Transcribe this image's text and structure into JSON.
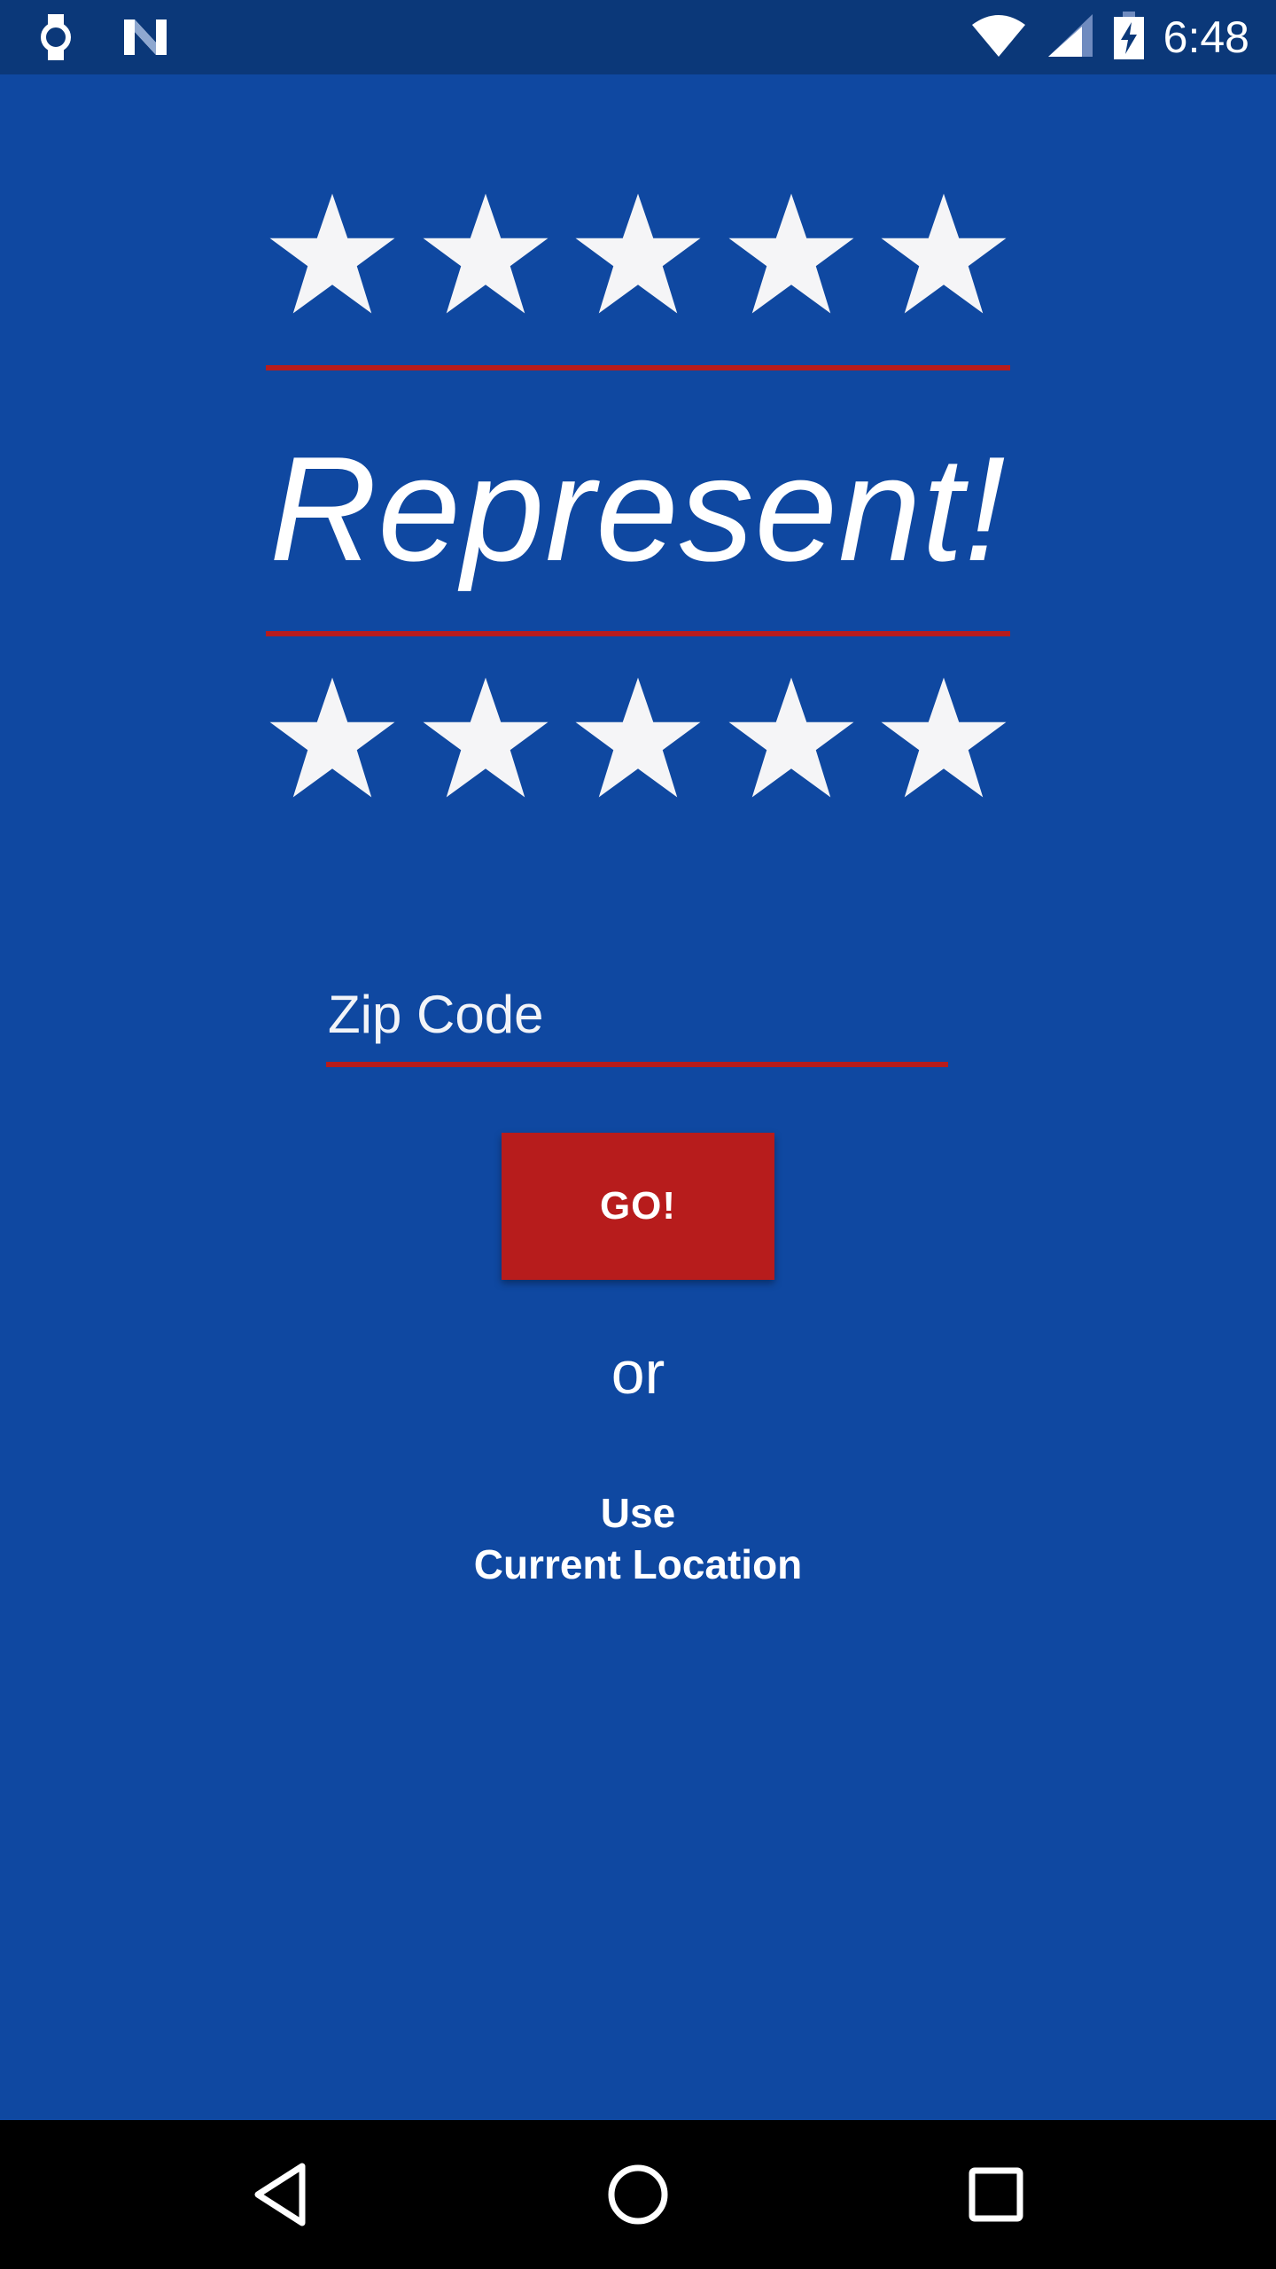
{
  "status_bar": {
    "time": "6:48",
    "left_icons": [
      "watch-icon",
      "n-notification-icon"
    ],
    "right_icons": [
      "wifi-icon",
      "cell-signal-icon",
      "battery-charging-icon"
    ],
    "background": "#0B3879"
  },
  "app": {
    "title": "Represent!",
    "top_stars_count": 5,
    "bottom_stars_count": 5,
    "zip_placeholder": "Zip Code",
    "go_label": "GO!",
    "or_label": "or",
    "location_line1": "Use",
    "location_line2": "Current Location",
    "colors": {
      "background": "#0F48A1",
      "accent_red": "#B71C1C",
      "star": "#F5F5F7"
    }
  },
  "nav_bar": {
    "icons": [
      "back-icon",
      "home-icon",
      "recents-icon"
    ]
  }
}
